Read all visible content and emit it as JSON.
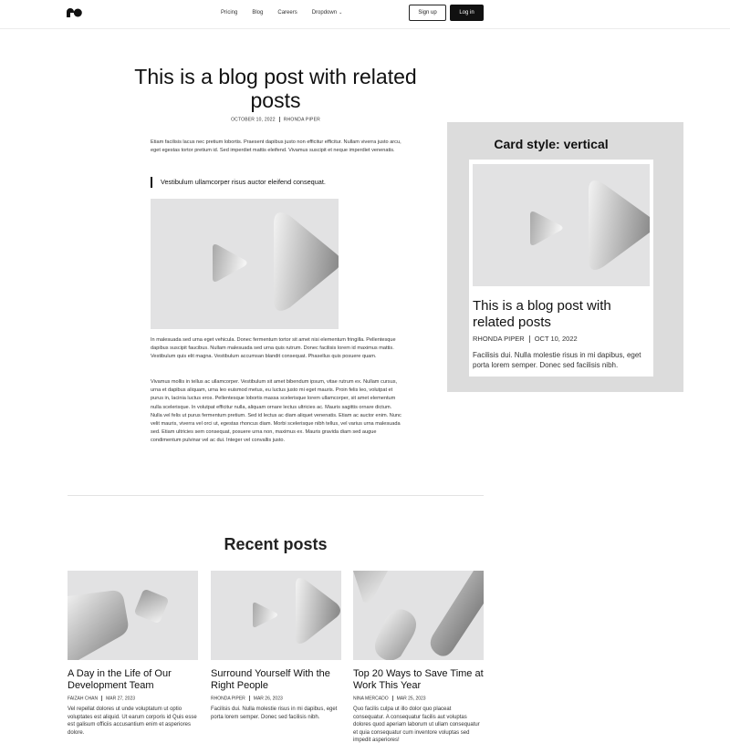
{
  "header": {
    "logo_icon": "brand-logo-icon",
    "nav": [
      "Pricing",
      "Blog",
      "Careers",
      "Dropdown"
    ],
    "signup_label": "Sign up",
    "login_label": "Log in"
  },
  "article": {
    "title": "This is a blog post with related posts",
    "date": "OCTOBER 10, 2022",
    "author": "RHONDA PIPER",
    "paragraph1": "Etiam facilisis lacus nec pretium lobortis. Praesent dapibus justo non efficitur efficitur. Nullam viverra justo arcu, eget egestas tortor pretium id. Sed imperdiet mattis eleifend. Vivamus suscipit et neque imperdiet venenatis.",
    "quote": "Vestibulum ullamcorper risus auctor eleifend consequat.",
    "paragraph2": "In malesuada sed urna eget vehicula. Donec fermentum tortor sit amet nisi elementum fringilla. Pellentesque dapibus suscipit faucibus. Nullam malesuada sed urna quis rutrum. Donec facilisis lorem id maximus mattis. Vestibulum quis elit magna. Vestibulum accumsan blandit consequat. Phasellus quis posuere quam.",
    "paragraph3": "Vivamus mollis in tellus ac ullamcorper. Vestibulum sit amet bibendum ipsum, vitae rutrum ex. Nullam cursus, urna et dapibus aliquam, urna leo euismod metus, eu luctus justo mi eget mauris. Proin felis leo, volutpat et purus in, lacinia luctus eros. Pellentesque lobortis massa scelerisque lorem ullamcorper, sit amet elementum nulla scelerisque. In volutpat efficitur nulla, aliquam ornare lectus ultricies ac. Mauris sagittis ornare dictum. Nulla vel felis ut purus fermentum pretium. Sed id lectus ac diam aliquet venenatis. Etiam ac auctor enim. Nunc velit mauris, viverra vel orci ut, egestas rhoncus diam. Morbi scelerisque nibh tellus, vel varius urna malesuada sed. Etiam ultricies sem consequat, posuere urna non, maximus ex. Mauris gravida diam sed augue condimentum pulvinar vel ac dui. Integer vel convallis justo."
  },
  "card_panel": {
    "heading": "Card style: vertical",
    "card": {
      "title": "This is a blog post with related posts",
      "author": "RHONDA PIPER",
      "date": "OCT 10, 2022",
      "excerpt": "Facilisis dui. Nulla molestie risus in mi dapibus, eget porta lorem semper. Donec sed facilisis nibh."
    }
  },
  "recent": {
    "heading": "Recent posts",
    "posts": [
      {
        "title": "A Day in the Life of Our Development Team",
        "author": "FAIZAH CHAN",
        "date": "MAR 27, 2023",
        "excerpt": "Vel repellat dolores ut unde voluptatum ut optio voluptates est aliquid. Ut earum corporis id Quis esse est galisum officiis accusantium enim et asperiores dolore."
      },
      {
        "title": "Surround Yourself With the Right People",
        "author": "RHONDA PIPER",
        "date": "MAR 26, 2023",
        "excerpt": "Facilisis dui. Nulla molestie risus in mi dapibus, eget porta lorem semper. Donec sed facilisis nibh."
      },
      {
        "title": "Top 20 Ways to Save Time at Work This Year",
        "author": "NINA MERCADO",
        "date": "MAR 25, 2023",
        "excerpt": "Quo facilis culpa ut illo dolor quo placeat consequatur. A consequatur facilis aut voluptas dolores quod aperiam laborum ut ullam consequatur et quia consequatur cum inventore voluptas sed impedit asperiores!"
      }
    ]
  }
}
